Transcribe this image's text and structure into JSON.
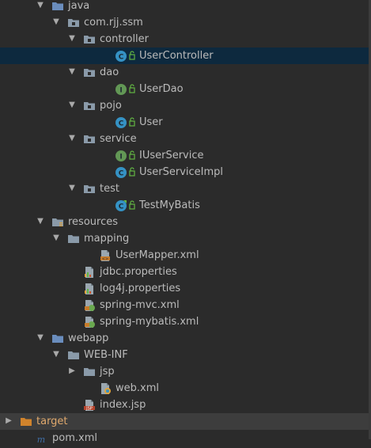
{
  "tree": [
    {
      "label": "java",
      "type": "folder-blue",
      "depth": 3,
      "expanded": true,
      "icon": "folder-icon"
    },
    {
      "label": "com.rjj.ssm",
      "type": "package",
      "depth": 4,
      "expanded": true,
      "icon": "package-icon"
    },
    {
      "label": "controller",
      "type": "package",
      "depth": 5,
      "expanded": true,
      "icon": "package-icon"
    },
    {
      "label": "UserController",
      "type": "class",
      "depth": 7,
      "selected": true,
      "icon": "class-icon"
    },
    {
      "label": "dao",
      "type": "package",
      "depth": 5,
      "expanded": true,
      "icon": "package-icon"
    },
    {
      "label": "UserDao",
      "type": "interface",
      "depth": 7,
      "icon": "interface-icon"
    },
    {
      "label": "pojo",
      "type": "package",
      "depth": 5,
      "expanded": true,
      "icon": "package-icon"
    },
    {
      "label": "User",
      "type": "class",
      "depth": 7,
      "icon": "class-icon"
    },
    {
      "label": "service",
      "type": "package",
      "depth": 5,
      "expanded": true,
      "icon": "package-icon"
    },
    {
      "label": "IUserService",
      "type": "interface",
      "depth": 7,
      "icon": "interface-icon"
    },
    {
      "label": "UserServiceImpl",
      "type": "class",
      "depth": 7,
      "icon": "class-icon"
    },
    {
      "label": "test",
      "type": "package",
      "depth": 5,
      "expanded": true,
      "icon": "package-icon"
    },
    {
      "label": "TestMyBatis",
      "type": "test-class",
      "depth": 7,
      "icon": "test-class-icon"
    },
    {
      "label": "resources",
      "type": "folder-res",
      "depth": 3,
      "expanded": true,
      "icon": "resources-folder-icon"
    },
    {
      "label": "mapping",
      "type": "folder",
      "depth": 4,
      "expanded": true,
      "icon": "folder-icon"
    },
    {
      "label": "UserMapper.xml",
      "type": "xml",
      "depth": 6,
      "icon": "xml-file-icon"
    },
    {
      "label": "jdbc.properties",
      "type": "properties",
      "depth": 5,
      "icon": "properties-file-icon"
    },
    {
      "label": "log4j.properties",
      "type": "properties",
      "depth": 5,
      "icon": "properties-file-icon"
    },
    {
      "label": "spring-mvc.xml",
      "type": "spring-xml",
      "depth": 5,
      "icon": "spring-xml-icon"
    },
    {
      "label": "spring-mybatis.xml",
      "type": "spring-xml",
      "depth": 5,
      "icon": "spring-xml-icon"
    },
    {
      "label": "webapp",
      "type": "folder-blue",
      "depth": 3,
      "expanded": true,
      "icon": "folder-icon"
    },
    {
      "label": "WEB-INF",
      "type": "folder",
      "depth": 4,
      "expanded": true,
      "icon": "folder-icon"
    },
    {
      "label": "jsp",
      "type": "folder",
      "depth": 5,
      "expanded": false,
      "icon": "folder-icon"
    },
    {
      "label": "web.xml",
      "type": "web-xml",
      "depth": 6,
      "icon": "web-xml-icon"
    },
    {
      "label": "index.jsp",
      "type": "jsp",
      "depth": 5,
      "icon": "jsp-file-icon"
    },
    {
      "label": "target",
      "type": "folder-orange",
      "depth": 1,
      "expanded": false,
      "dim": true,
      "icon": "folder-icon"
    },
    {
      "label": "pom.xml",
      "type": "maven",
      "depth": 2,
      "icon": "maven-icon"
    }
  ],
  "colors": {
    "background": "#2b2b2b",
    "selection": "#0d293e",
    "excluded_row": "#3d3d3d",
    "text": "#bbbbbb",
    "class_icon": "#3592c4",
    "interface_icon": "#629755",
    "folder": "#8a9aa9",
    "folder_blue": "#6a8dbd",
    "folder_orange": "#d0832c"
  }
}
